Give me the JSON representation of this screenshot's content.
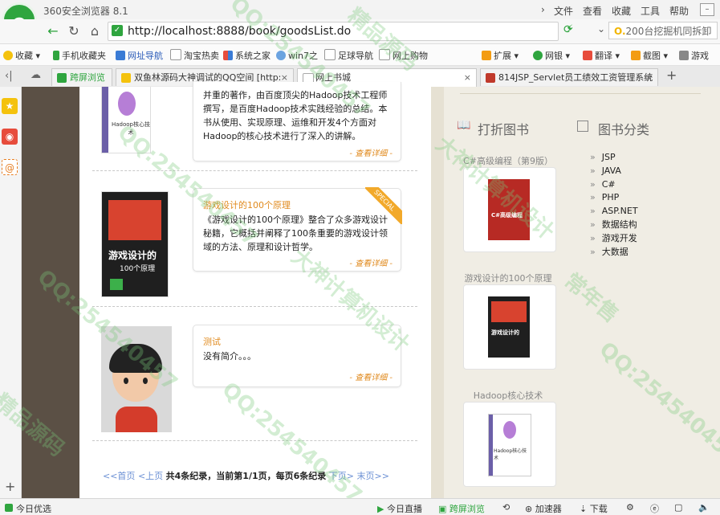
{
  "titlebar": {
    "app_title": "360安全浏览器 8.1",
    "menu": [
      "文件",
      "查看",
      "收藏",
      "工具",
      "帮助"
    ]
  },
  "nav": {
    "url": "http://localhost:8888/book/goodsList.do",
    "search_text": "200台挖掘机同拆卸"
  },
  "bookmarks": {
    "left": [
      "收藏",
      "手机收藏夹",
      "网址导航",
      "淘宝热卖",
      "系统之家",
      "win7之",
      "足球导航",
      "网上购物"
    ],
    "right": [
      "扩展",
      "网银",
      "翻译",
      "截图",
      "游戏"
    ]
  },
  "tabs": [
    {
      "label": "跨屏浏览"
    },
    {
      "label": "双鱼林源码大神调试的QQ空间 [http:"
    },
    {
      "label": "网上书城"
    },
    {
      "label": "814JSP_Servlet员工绩效工资管理系统"
    }
  ],
  "books": [
    {
      "title": "",
      "desc": "并重的著作，由百度顶尖的Hadoop技术工程师撰写，是百度Hadoop技术实践经验的总结。本书从使用、实现原理、运维和开发4个方面对Hadoop的核心技术进行了深入的讲解。",
      "more": "- 查看详细 -",
      "cover_title": "Hadoop核心技术",
      "cover_color": "#ffffff"
    },
    {
      "title": "游戏设计的100个原理",
      "desc": "《游戏设计的100个原理》整合了众多游戏设计秘籍，它概括并阐释了100条重要的游戏设计领域的方法、原理和设计哲学。",
      "more": "- 查看详细 -",
      "badge": "SPECIAL",
      "cover_title": "游戏设计的",
      "cover_sub": "100个原理",
      "cover_color": "#1f1f1f"
    },
    {
      "title": "测试",
      "desc": "没有简介。。。",
      "more": "- 查看详细 -",
      "cover_color": "#d9d9d9"
    }
  ],
  "pager": {
    "first": "<<首页",
    "prev": "<上页",
    "info": "共4条纪录，当前第1/1页，每页6条纪录",
    "next": "下页>",
    "last": "末页>>"
  },
  "right": {
    "discount_title": "打折图书",
    "category_title": "图书分类",
    "discount_books": [
      {
        "title": "C#高级编程（第9版）",
        "cover_text": "C#高级编程"
      },
      {
        "title": "游戏设计的100个原理",
        "cover_text": "游戏设计的"
      },
      {
        "title": "Hadoop核心技术",
        "cover_text": "Hadoop核心技术"
      }
    ],
    "categories": [
      "JSP",
      "JAVA",
      "C#",
      "PHP",
      "ASP.NET",
      "数据结构",
      "游戏开发",
      "大数据"
    ]
  },
  "statusbar": {
    "left": "今日优选",
    "items": [
      "今日直播",
      "跨屏浏览",
      "加速器",
      "下载"
    ]
  },
  "watermark": {
    "qq": "QQ:254540457",
    "text1": "大神计算机设计",
    "text2": "精品源码",
    "text3": "常年售"
  }
}
